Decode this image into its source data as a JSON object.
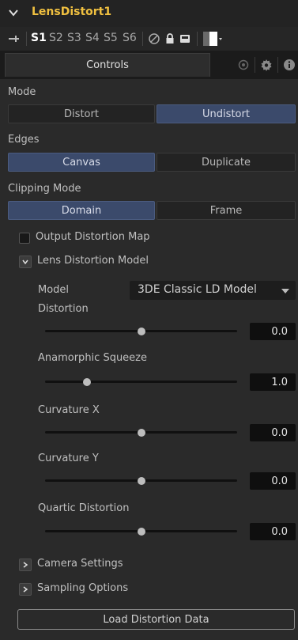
{
  "header": {
    "title": "LensDistort1"
  },
  "versions": {
    "items": [
      "S1",
      "S2",
      "S3",
      "S4",
      "S5",
      "S6"
    ],
    "active": "S1"
  },
  "tabs": {
    "controls_label": "Controls"
  },
  "mode": {
    "label": "Mode",
    "options": [
      "Distort",
      "Undistort"
    ],
    "selected": "Undistort"
  },
  "edges": {
    "label": "Edges",
    "options": [
      "Canvas",
      "Duplicate"
    ],
    "selected": "Canvas"
  },
  "clipping": {
    "label": "Clipping Mode",
    "options": [
      "Domain",
      "Frame"
    ],
    "selected": "Domain"
  },
  "output_map": {
    "label": "Output Distortion Map",
    "checked": false
  },
  "lens_model_section": {
    "label": "Lens Distortion Model",
    "expanded": true
  },
  "model": {
    "label": "Model",
    "value": "3DE Classic LD Model"
  },
  "sliders": [
    {
      "label": "Distortion",
      "value": "0.0",
      "fraction": 0.5
    },
    {
      "label": "Anamorphic Squeeze",
      "value": "1.0",
      "fraction": 0.22
    },
    {
      "label": "Curvature X",
      "value": "0.0",
      "fraction": 0.5
    },
    {
      "label": "Curvature Y",
      "value": "0.0",
      "fraction": 0.5
    },
    {
      "label": "Quartic Distortion",
      "value": "0.0",
      "fraction": 0.5
    }
  ],
  "camera_section": {
    "label": "Camera Settings",
    "expanded": false
  },
  "sampling_section": {
    "label": "Sampling Options",
    "expanded": false
  },
  "load_button": {
    "label": "Load Distortion Data"
  },
  "colors": {
    "title": "#f0c040",
    "selected_button": "#3b4a6b",
    "panel": "#2a2a2a"
  }
}
